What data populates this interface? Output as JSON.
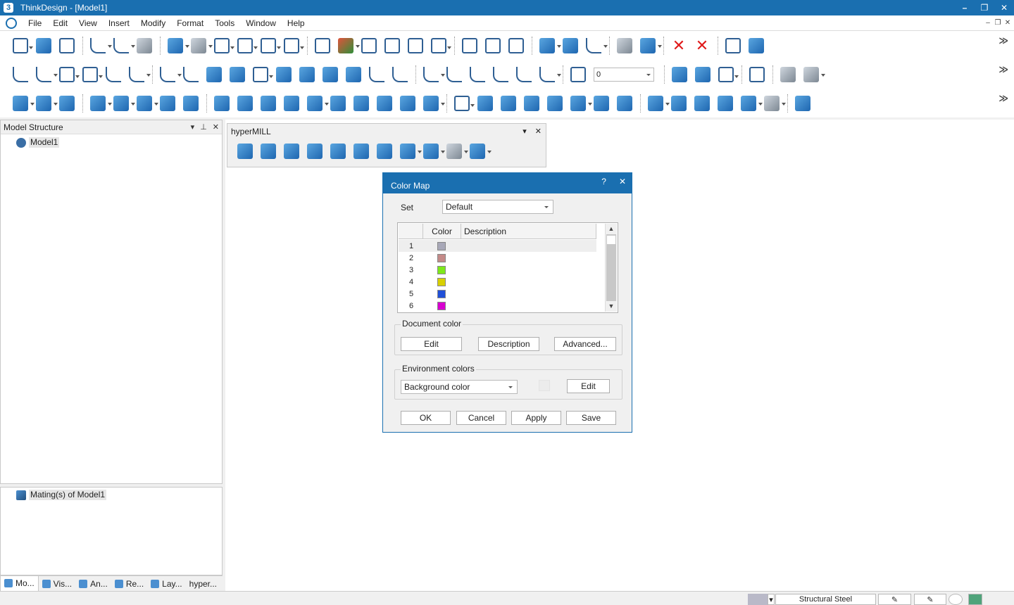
{
  "window": {
    "title": "ThinkDesign  - [Model1]",
    "logo_text": "3",
    "minimize": "–",
    "restore": "❐",
    "close": "✕"
  },
  "menu": [
    "File",
    "Edit",
    "View",
    "Insert",
    "Modify",
    "Format",
    "Tools",
    "Window",
    "Help"
  ],
  "toolbar": {
    "more": "≫",
    "layer_value": "0"
  },
  "model_structure": {
    "title": "Model Structure",
    "tree_root": "Model1",
    "header_buttons": [
      "▾",
      "⊥",
      "✕"
    ]
  },
  "mating_panel": {
    "item": "Mating(s) of Model1"
  },
  "bottom_tabs": [
    "Mo...",
    "Vis...",
    "An...",
    "Re...",
    "Lay...",
    "hyper..."
  ],
  "hypermill": {
    "title": "hyperMILL",
    "header_buttons": [
      "▾",
      "✕"
    ]
  },
  "color_map": {
    "title": "Color Map",
    "help": "?",
    "close": "✕",
    "set_label": "Set",
    "set_value": "Default",
    "columns": {
      "color": "Color",
      "description": "Description"
    },
    "rows": [
      {
        "num": "1",
        "color": "#a8a8b8"
      },
      {
        "num": "2",
        "color": "#c48a88"
      },
      {
        "num": "3",
        "color": "#7ee81a"
      },
      {
        "num": "4",
        "color": "#d8d000"
      },
      {
        "num": "5",
        "color": "#2050d8"
      },
      {
        "num": "6",
        "color": "#d800d0"
      }
    ],
    "scroll_up": "▲",
    "scroll_down": "▼",
    "document_color": {
      "label": "Document color",
      "edit": "Edit",
      "description": "Description",
      "advanced": "Advanced..."
    },
    "environment_colors": {
      "label": "Environment colors",
      "combo": "Background color",
      "edit": "Edit"
    },
    "buttons": {
      "ok": "OK",
      "cancel": "Cancel",
      "apply": "Apply",
      "save": "Save"
    }
  },
  "statusbar": {
    "material": "Structural Steel"
  }
}
